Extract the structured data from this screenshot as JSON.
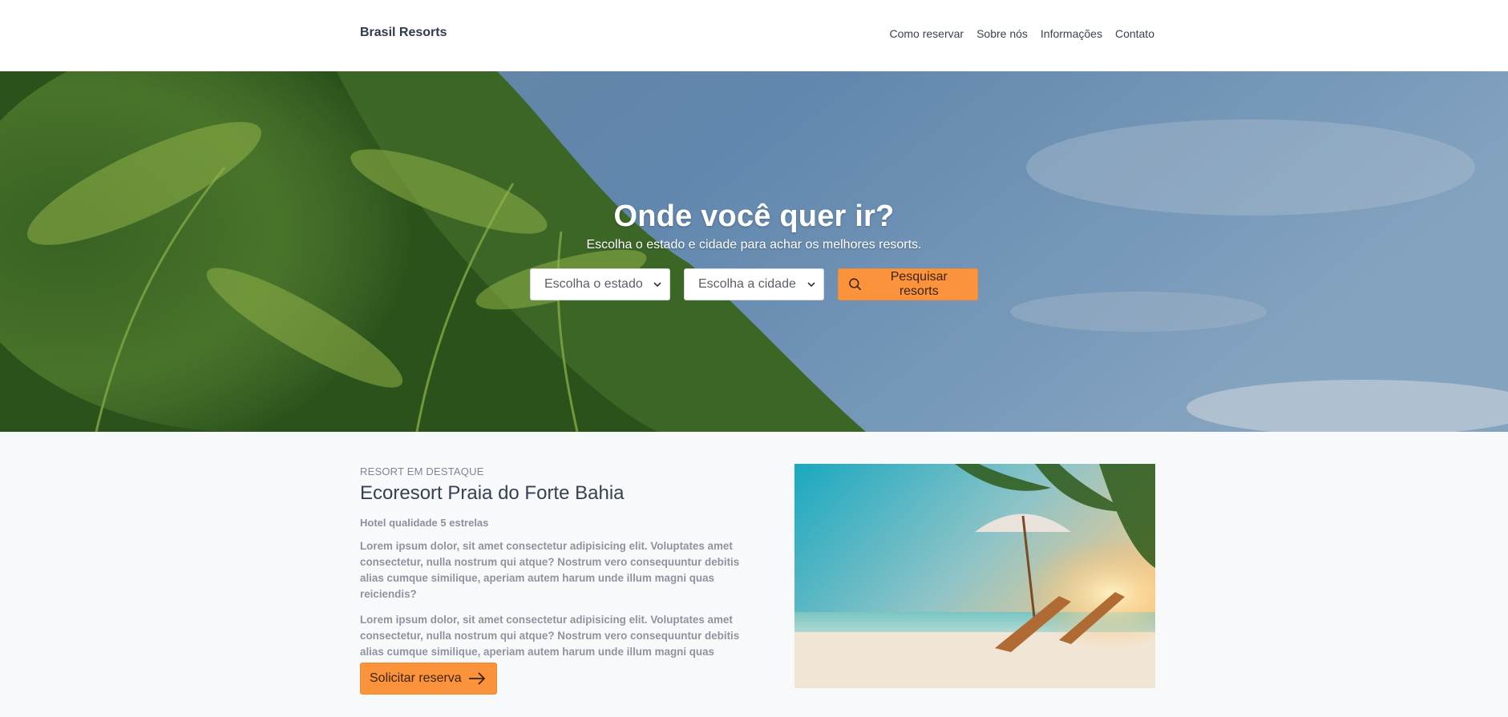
{
  "header": {
    "brand": "Brasil Resorts",
    "nav": [
      "Como reservar",
      "Sobre nós",
      "Informações",
      "Contato"
    ]
  },
  "hero": {
    "title": "Onde você quer ir?",
    "subtitle": "Escolha o estado e cidade para achar os melhores resorts.",
    "state_select": "Escolha o estado",
    "city_select": "Escolha a cidade",
    "search_button": "Pesquisar resorts"
  },
  "featured": {
    "eyebrow": "RESORT EM DESTAQUE",
    "title": "Ecoresort Praia do Forte Bahia",
    "stars": "Hotel qualidade 5 estrelas",
    "paragraph1": "Lorem ipsum dolor, sit amet consectetur adipisicing elit. Voluptates amet consectetur, nulla nostrum qui atque? Nostrum vero consequuntur debitis alias cumque similique, aperiam autem harum unde illum magni quas reiciendis?",
    "paragraph2": "Lorem ipsum dolor, sit amet consectetur adipisicing elit. Voluptates amet consectetur, nulla nostrum qui atque? Nostrum vero consequuntur debitis alias cumque similique, aperiam autem harum unde illum magni quas reiciendis?",
    "reserve_button": "Solicitar reserva"
  },
  "colors": {
    "accent": "#fb923c",
    "featured_bg": "#f8f9fb",
    "text_dark": "#364152"
  },
  "icons": {
    "search": "search-icon",
    "arrow": "arrow-right-icon",
    "chevron": "chevron-down-icon"
  }
}
